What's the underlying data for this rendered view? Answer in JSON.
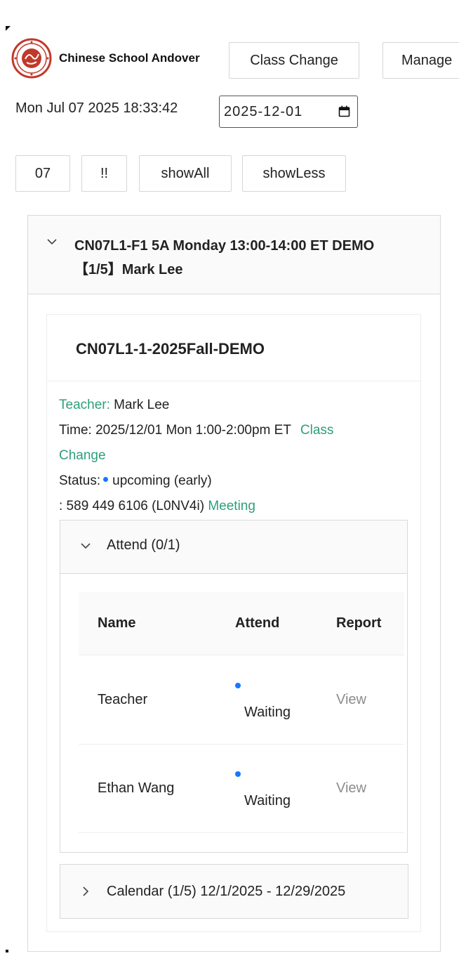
{
  "header": {
    "school_name": "Chinese School Andover",
    "logo_icon": "school-seal-logo",
    "buttons": {
      "class_change": "Class Change",
      "manage": "Manage"
    },
    "clock": "Mon Jul 07 2025 18:33:42",
    "date_value": "2025-12-01"
  },
  "toolbar": {
    "btn_07": "07",
    "btn_bang": "!!",
    "show_all": "showAll",
    "show_less": "showLess"
  },
  "class_panel": {
    "title_line1": "CN07L1-F1 5A Monday 13:00-14:00 ET DEMO",
    "title_line2": "【1/5】Mark Lee",
    "expanded": true
  },
  "card": {
    "title": "CN07L1-1-2025Fall-DEMO",
    "teacher_label": "Teacher:",
    "teacher_name": "Mark Lee",
    "time_text": "Time: 2025/12/01 Mon 1:00-2:00pm ET",
    "class_change_link_1": "Class",
    "class_change_link_2": "Change",
    "status_label": "Status:",
    "status_value": "upcoming (early)",
    "meeting_text": ": 589 449 6106 (L0NV4i)",
    "meeting_link": "Meeting"
  },
  "attend": {
    "title": "Attend (0/1)",
    "columns": [
      "Name",
      "Attend",
      "Report"
    ],
    "rows": [
      {
        "name": "Teacher",
        "attend": "Waiting",
        "report": "View"
      },
      {
        "name": "Ethan Wang",
        "attend": "Waiting",
        "report": "View"
      }
    ]
  },
  "calendar": {
    "title": "Calendar (1/5) 12/1/2025 - 12/29/2025"
  },
  "colors": {
    "link_green": "#2e9e7c",
    "status_blue": "#1677ff",
    "muted_gray": "#8c8c8c",
    "panel_bg": "#fafafa",
    "border": "#d9d9d9"
  }
}
